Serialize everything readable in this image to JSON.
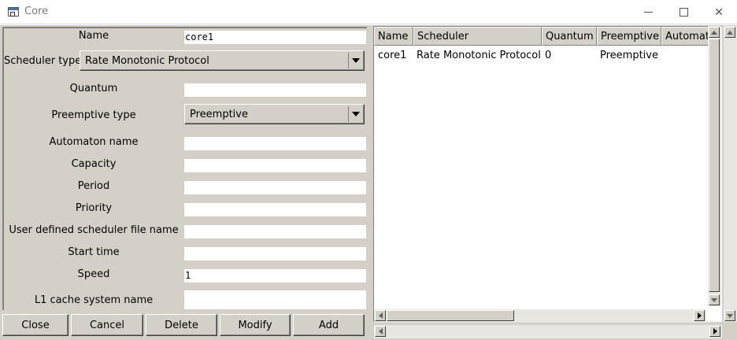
{
  "window": {
    "title": "Core"
  },
  "form": {
    "name_label": "Name",
    "name_value": "core1",
    "scheduler_type_label": "Scheduler type",
    "scheduler_type_value": "Rate Monotonic Protocol",
    "quantum_label": "Quantum",
    "quantum_value": "",
    "preemptive_type_label": "Preemptive type",
    "preemptive_type_value": "Preemptive",
    "automaton_name_label": "Automaton name",
    "automaton_name_value": "",
    "capacity_label": "Capacity",
    "capacity_value": "",
    "period_label": "Period",
    "period_value": "",
    "priority_label": "Priority",
    "priority_value": "",
    "user_scheduler_label": "User defined scheduler file name",
    "user_scheduler_value": "",
    "start_time_label": "Start time",
    "start_time_value": "",
    "speed_label": "Speed",
    "speed_value": "1",
    "l1_cache_label": "L1 cache system name",
    "l1_cache_value": ""
  },
  "buttons": {
    "close": "Close",
    "cancel": "Cancel",
    "delete": "Delete",
    "modify": "Modify",
    "add": "Add"
  },
  "table": {
    "columns": [
      "Name",
      "Scheduler",
      "Quantum",
      "Preemptive",
      "Automaton"
    ],
    "rows": [
      [
        "core1",
        "Rate Monotonic Protocol",
        "0",
        "Preemptive",
        ""
      ]
    ]
  }
}
